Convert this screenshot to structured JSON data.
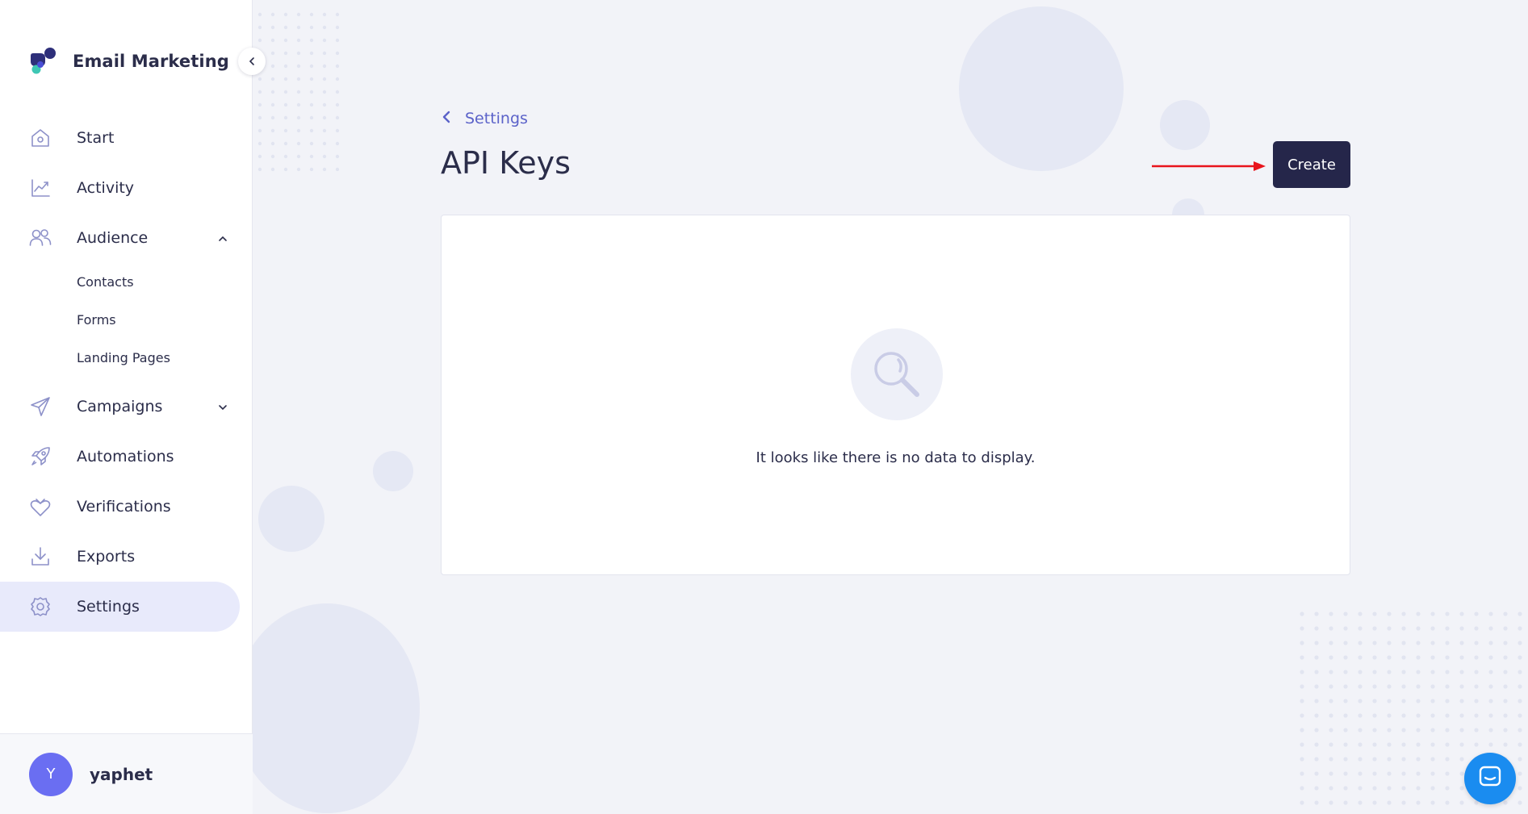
{
  "brand": {
    "title": "Email Marketing"
  },
  "sidebar": {
    "items": [
      {
        "label": "Start",
        "icon": "home-icon"
      },
      {
        "label": "Activity",
        "icon": "chart-line-icon"
      },
      {
        "label": "Audience",
        "icon": "users-icon",
        "expanded": true
      },
      {
        "label": "Campaigns",
        "icon": "paper-plane-icon",
        "expanded": false
      },
      {
        "label": "Automations",
        "icon": "rocket-icon"
      },
      {
        "label": "Verifications",
        "icon": "heart-check-icon"
      },
      {
        "label": "Exports",
        "icon": "download-icon"
      },
      {
        "label": "Settings",
        "icon": "gear-icon",
        "active": true
      }
    ],
    "audience_sub": [
      "Contacts",
      "Forms",
      "Landing Pages"
    ]
  },
  "user": {
    "initial": "Y",
    "name": "yaphet"
  },
  "breadcrumb": {
    "label": "Settings"
  },
  "page": {
    "title": "API Keys",
    "create_label": "Create"
  },
  "empty_state": {
    "message": "It looks like there is no data to display."
  },
  "colors": {
    "accent": "#5b62c9",
    "button_dark": "#25264a",
    "avatar": "#6a6ef2",
    "chat": "#1a8cf0",
    "annotation_arrow": "#e8141c"
  }
}
